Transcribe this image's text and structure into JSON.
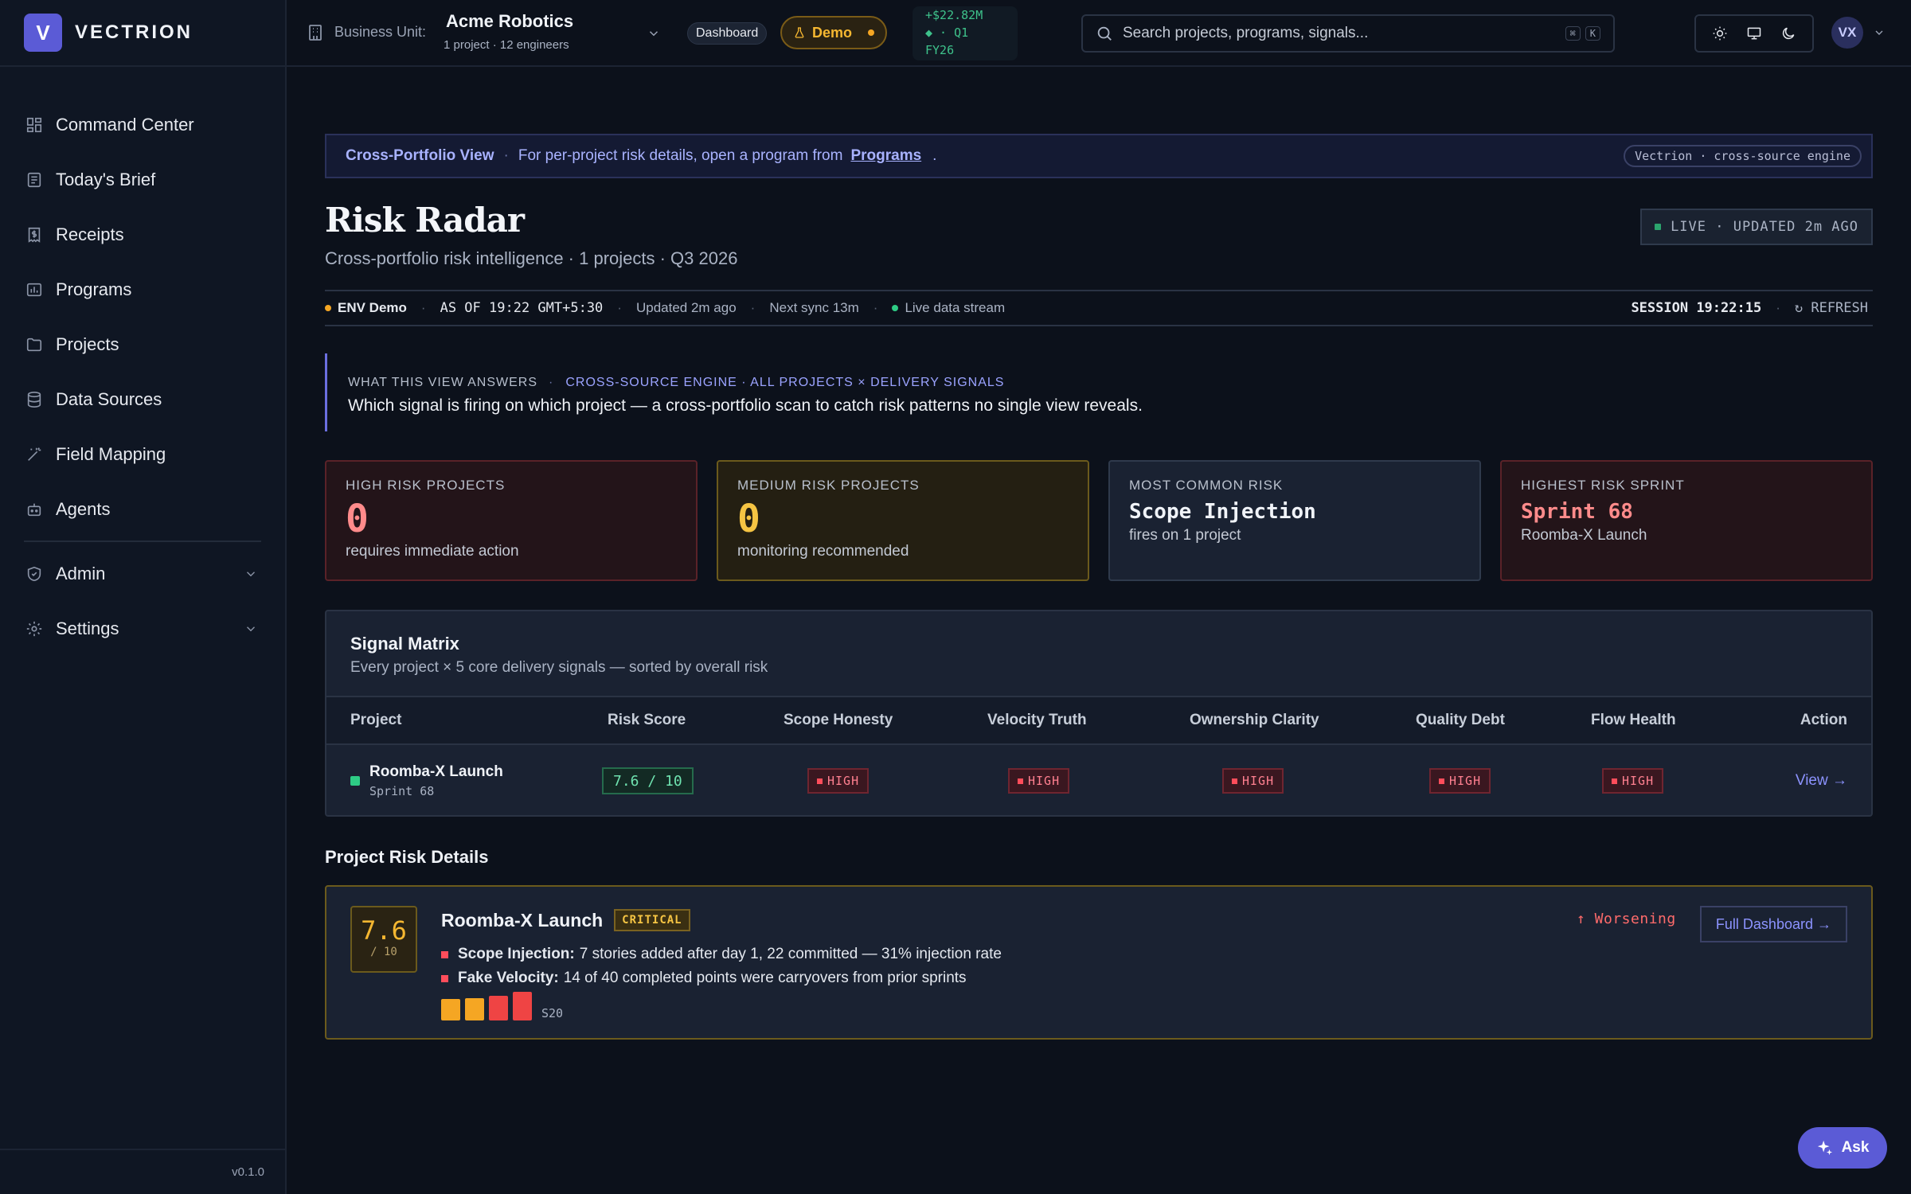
{
  "brand": {
    "logo_letter": "V",
    "name": "VECTRION"
  },
  "sidebar": {
    "items": [
      {
        "label": "Command Center",
        "icon": "grid-icon"
      },
      {
        "label": "Today's Brief",
        "icon": "newspaper-icon"
      },
      {
        "label": "Receipts",
        "icon": "receipt-icon"
      },
      {
        "label": "Programs",
        "icon": "chart-icon"
      },
      {
        "label": "Projects",
        "icon": "folder-icon"
      },
      {
        "label": "Data Sources",
        "icon": "database-icon"
      },
      {
        "label": "Field Mapping",
        "icon": "wand-icon"
      },
      {
        "label": "Agents",
        "icon": "bot-icon"
      }
    ],
    "groups": [
      {
        "label": "Admin",
        "icon": "shield-icon"
      },
      {
        "label": "Settings",
        "icon": "gear-icon"
      }
    ],
    "version": "v0.1.0"
  },
  "topbar": {
    "bu_label": "Business Unit:",
    "bu_name": "Acme Robotics",
    "bu_sub": "1 project · 12 engineers",
    "dashboard_pill": "Dashboard",
    "demo_pill": "Demo",
    "revenue_line1": "+$22.82M",
    "revenue_line2": "◆ · Q1",
    "revenue_line3": "FY26",
    "search_placeholder": "Search projects, programs, signals...",
    "kbd1": "⌘",
    "kbd2": "K",
    "avatar": "VX"
  },
  "banner": {
    "title": "Cross-Portfolio View",
    "text": "For per-project risk details, open a program from",
    "link": "Programs",
    "period": ".",
    "engine": "Vectrion · cross-source engine"
  },
  "header": {
    "title": "Risk Radar",
    "subtitle": "Cross-portfolio risk intelligence · 1 projects · Q3 2026",
    "live": "LIVE · UPDATED 2m AGO"
  },
  "status": {
    "env": "ENV Demo",
    "asof": "AS OF 19:22 GMT+5:30",
    "updated": "Updated 2m ago",
    "next_sync": "Next sync 13m",
    "stream": "Live data stream",
    "session": "SESSION 19:22:15",
    "refresh": "↻ REFRESH"
  },
  "answers": {
    "k1": "WHAT THIS VIEW ANSWERS",
    "k2": "CROSS-SOURCE ENGINE · ALL PROJECTS × DELIVERY SIGNALS",
    "question": "Which signal is firing on which project — a cross-portfolio scan to catch risk patterns no single view reveals."
  },
  "kpis": [
    {
      "label": "HIGH RISK PROJECTS",
      "value": "0",
      "sub": "requires immediate action"
    },
    {
      "label": "MEDIUM RISK PROJECTS",
      "value": "0",
      "sub": "monitoring recommended"
    },
    {
      "label": "MOST COMMON RISK",
      "value": "Scope Injection",
      "sub": "fires on 1 project"
    },
    {
      "label": "HIGHEST RISK SPRINT",
      "value": "Sprint 68",
      "sub": "Roomba-X Launch"
    }
  ],
  "matrix": {
    "title": "Signal Matrix",
    "subtitle": "Every project × 5 core delivery signals — sorted by overall risk",
    "columns": [
      "Project",
      "Risk Score",
      "Scope Honesty",
      "Velocity Truth",
      "Ownership Clarity",
      "Quality Debt",
      "Flow Health",
      "Action"
    ],
    "row": {
      "project": "Roomba-X Launch",
      "sprint": "Sprint 68",
      "score": "7.6 / 10",
      "signals": [
        "HIGH",
        "HIGH",
        "HIGH",
        "HIGH",
        "HIGH"
      ],
      "action": "View →"
    }
  },
  "details": {
    "section_title": "Project Risk Details",
    "score": "7.6",
    "score_den": "/ 10",
    "project": "Roomba-X Launch",
    "badge": "CRITICAL",
    "trend": "↑ Worsening",
    "button": "Full Dashboard →",
    "lines": [
      {
        "label": "Scope Injection:",
        "text": "7 stories added after day 1, 22 committed — 31% injection rate"
      },
      {
        "label": "Fake Velocity:",
        "text": "14 of 40 completed points were carryovers from prior sprints"
      }
    ],
    "sprint_bars": [
      {
        "level": 0.75,
        "color": "#f5a623"
      },
      {
        "level": 0.78,
        "color": "#f5a623"
      },
      {
        "level": 0.85,
        "color": "#ef4444"
      },
      {
        "level": 1.0,
        "color": "#ef4444"
      }
    ],
    "sprint_label": "S20"
  },
  "ask": "Ask"
}
